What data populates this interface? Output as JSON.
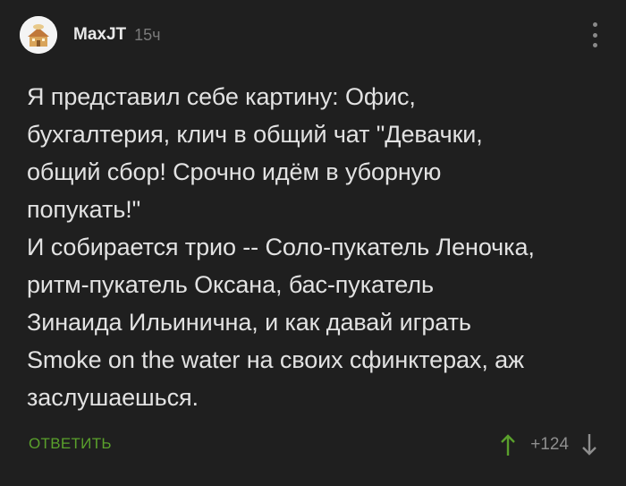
{
  "comment": {
    "author": "MaxJT",
    "time": "15ч",
    "text": "Я представил себе картину: Офис,\nбухгалтерия, клич в общий чат \"Девачки,\nобщий сбор! Срочно идём в уборную\nпопукать!\"\nИ собирается трио -- Соло-пукатель Леночка,\nритм-пукатель Оксана, бас-пукатель\nЗинаида Ильинична, и как давай играть\nSmoke on the water на своих сфинктерах, аж\nзаслушаешься.",
    "reply_label": "ОТВЕТИТЬ",
    "rating": "+124"
  },
  "colors": {
    "background": "#1f1f1f",
    "text": "#e2e2e2",
    "reply": "#5aa02c",
    "upvote": "#5aa02c",
    "muted": "#8e8e8e"
  },
  "icons": {
    "avatar": "user-avatar",
    "menu": "more-vertical-icon",
    "up": "arrow-up-icon",
    "down": "arrow-down-icon"
  }
}
